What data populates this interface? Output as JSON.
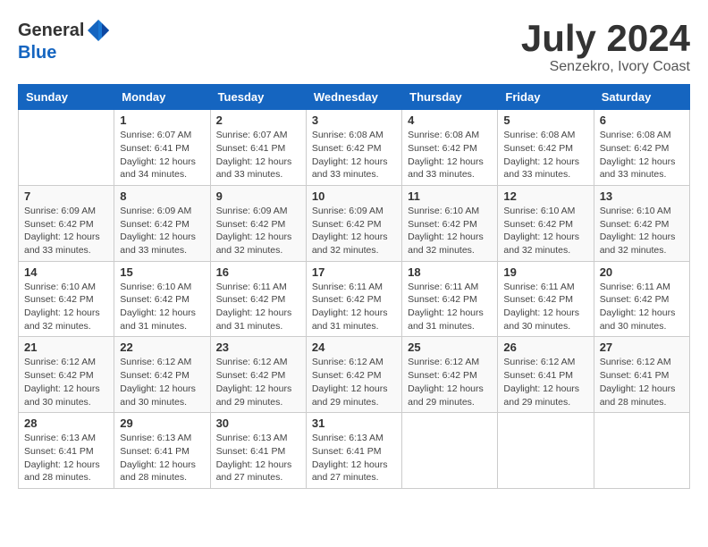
{
  "header": {
    "logo_general": "General",
    "logo_blue": "Blue",
    "title": "July 2024",
    "location": "Senzekro, Ivory Coast"
  },
  "weekdays": [
    "Sunday",
    "Monday",
    "Tuesday",
    "Wednesday",
    "Thursday",
    "Friday",
    "Saturday"
  ],
  "weeks": [
    [
      {
        "day": "",
        "info": ""
      },
      {
        "day": "1",
        "info": "Sunrise: 6:07 AM\nSunset: 6:41 PM\nDaylight: 12 hours\nand 34 minutes."
      },
      {
        "day": "2",
        "info": "Sunrise: 6:07 AM\nSunset: 6:41 PM\nDaylight: 12 hours\nand 33 minutes."
      },
      {
        "day": "3",
        "info": "Sunrise: 6:08 AM\nSunset: 6:42 PM\nDaylight: 12 hours\nand 33 minutes."
      },
      {
        "day": "4",
        "info": "Sunrise: 6:08 AM\nSunset: 6:42 PM\nDaylight: 12 hours\nand 33 minutes."
      },
      {
        "day": "5",
        "info": "Sunrise: 6:08 AM\nSunset: 6:42 PM\nDaylight: 12 hours\nand 33 minutes."
      },
      {
        "day": "6",
        "info": "Sunrise: 6:08 AM\nSunset: 6:42 PM\nDaylight: 12 hours\nand 33 minutes."
      }
    ],
    [
      {
        "day": "7",
        "info": "Sunrise: 6:09 AM\nSunset: 6:42 PM\nDaylight: 12 hours\nand 33 minutes."
      },
      {
        "day": "8",
        "info": "Sunrise: 6:09 AM\nSunset: 6:42 PM\nDaylight: 12 hours\nand 33 minutes."
      },
      {
        "day": "9",
        "info": "Sunrise: 6:09 AM\nSunset: 6:42 PM\nDaylight: 12 hours\nand 32 minutes."
      },
      {
        "day": "10",
        "info": "Sunrise: 6:09 AM\nSunset: 6:42 PM\nDaylight: 12 hours\nand 32 minutes."
      },
      {
        "day": "11",
        "info": "Sunrise: 6:10 AM\nSunset: 6:42 PM\nDaylight: 12 hours\nand 32 minutes."
      },
      {
        "day": "12",
        "info": "Sunrise: 6:10 AM\nSunset: 6:42 PM\nDaylight: 12 hours\nand 32 minutes."
      },
      {
        "day": "13",
        "info": "Sunrise: 6:10 AM\nSunset: 6:42 PM\nDaylight: 12 hours\nand 32 minutes."
      }
    ],
    [
      {
        "day": "14",
        "info": "Sunrise: 6:10 AM\nSunset: 6:42 PM\nDaylight: 12 hours\nand 32 minutes."
      },
      {
        "day": "15",
        "info": "Sunrise: 6:10 AM\nSunset: 6:42 PM\nDaylight: 12 hours\nand 31 minutes."
      },
      {
        "day": "16",
        "info": "Sunrise: 6:11 AM\nSunset: 6:42 PM\nDaylight: 12 hours\nand 31 minutes."
      },
      {
        "day": "17",
        "info": "Sunrise: 6:11 AM\nSunset: 6:42 PM\nDaylight: 12 hours\nand 31 minutes."
      },
      {
        "day": "18",
        "info": "Sunrise: 6:11 AM\nSunset: 6:42 PM\nDaylight: 12 hours\nand 31 minutes."
      },
      {
        "day": "19",
        "info": "Sunrise: 6:11 AM\nSunset: 6:42 PM\nDaylight: 12 hours\nand 30 minutes."
      },
      {
        "day": "20",
        "info": "Sunrise: 6:11 AM\nSunset: 6:42 PM\nDaylight: 12 hours\nand 30 minutes."
      }
    ],
    [
      {
        "day": "21",
        "info": "Sunrise: 6:12 AM\nSunset: 6:42 PM\nDaylight: 12 hours\nand 30 minutes."
      },
      {
        "day": "22",
        "info": "Sunrise: 6:12 AM\nSunset: 6:42 PM\nDaylight: 12 hours\nand 30 minutes."
      },
      {
        "day": "23",
        "info": "Sunrise: 6:12 AM\nSunset: 6:42 PM\nDaylight: 12 hours\nand 29 minutes."
      },
      {
        "day": "24",
        "info": "Sunrise: 6:12 AM\nSunset: 6:42 PM\nDaylight: 12 hours\nand 29 minutes."
      },
      {
        "day": "25",
        "info": "Sunrise: 6:12 AM\nSunset: 6:42 PM\nDaylight: 12 hours\nand 29 minutes."
      },
      {
        "day": "26",
        "info": "Sunrise: 6:12 AM\nSunset: 6:41 PM\nDaylight: 12 hours\nand 29 minutes."
      },
      {
        "day": "27",
        "info": "Sunrise: 6:12 AM\nSunset: 6:41 PM\nDaylight: 12 hours\nand 28 minutes."
      }
    ],
    [
      {
        "day": "28",
        "info": "Sunrise: 6:13 AM\nSunset: 6:41 PM\nDaylight: 12 hours\nand 28 minutes."
      },
      {
        "day": "29",
        "info": "Sunrise: 6:13 AM\nSunset: 6:41 PM\nDaylight: 12 hours\nand 28 minutes."
      },
      {
        "day": "30",
        "info": "Sunrise: 6:13 AM\nSunset: 6:41 PM\nDaylight: 12 hours\nand 27 minutes."
      },
      {
        "day": "31",
        "info": "Sunrise: 6:13 AM\nSunset: 6:41 PM\nDaylight: 12 hours\nand 27 minutes."
      },
      {
        "day": "",
        "info": ""
      },
      {
        "day": "",
        "info": ""
      },
      {
        "day": "",
        "info": ""
      }
    ]
  ]
}
